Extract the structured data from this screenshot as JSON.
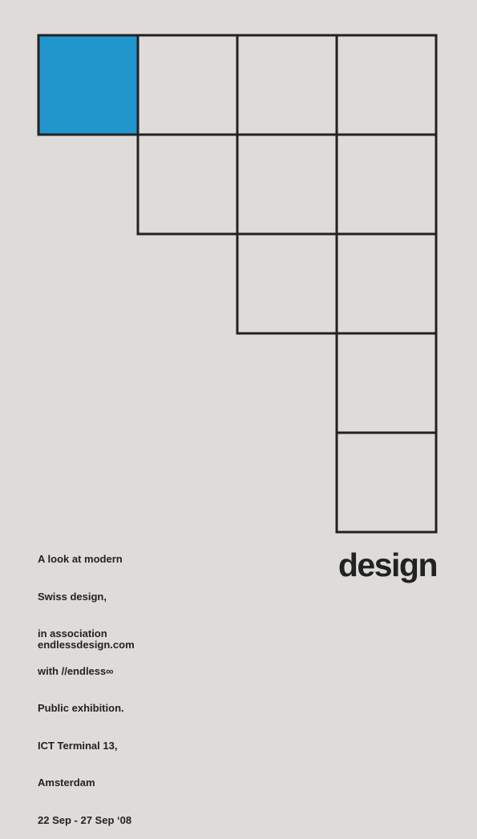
{
  "colors": {
    "background": "#dedcd8",
    "accent_square": "#2196cc",
    "line": "#222222",
    "text": "#222222"
  },
  "grid": {
    "rows": [
      4,
      3,
      2,
      1,
      1
    ],
    "highlighted_cell": "row-1-col-1"
  },
  "info_lines": [
    "A look at modern",
    "Swiss design,",
    "in association",
    "with //endless∞",
    "Public exhibition.",
    "ICT Terminal 13,",
    "Amsterdam",
    "22 Sep - 27 Sep ‘08"
  ],
  "website": "endlessdesign.com",
  "headline": "design"
}
